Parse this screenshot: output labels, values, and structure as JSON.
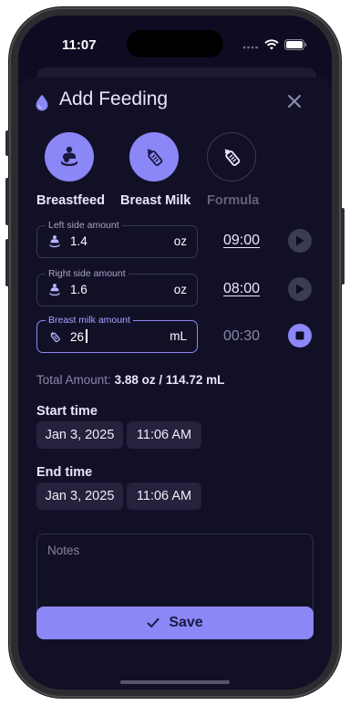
{
  "status": {
    "time": "11:07"
  },
  "header": {
    "title": "Add Feeding"
  },
  "types": [
    {
      "label": "Breastfeed",
      "active": true
    },
    {
      "label": "Breast Milk",
      "active": true
    },
    {
      "label": "Formula",
      "active": false
    }
  ],
  "fields": {
    "left": {
      "legend": "Left side amount",
      "value": "1.4",
      "unit": "oz",
      "timer": "09:00"
    },
    "right": {
      "legend": "Right side amount",
      "value": "1.6",
      "unit": "oz",
      "timer": "08:00"
    },
    "milk": {
      "legend": "Breast milk amount",
      "value": "26",
      "unit": "mL",
      "timer": "00:30"
    }
  },
  "total": {
    "label": "Total Amount:",
    "value": "3.88 oz / 114.72 mL"
  },
  "start": {
    "label": "Start time",
    "date": "Jan 3, 2025",
    "time": "11:06 AM"
  },
  "end": {
    "label": "End time",
    "date": "Jan 3, 2025",
    "time": "11:06 AM"
  },
  "notes": {
    "placeholder": "Notes"
  },
  "save": {
    "label": "Save"
  },
  "colors": {
    "accent": "#8c87f6",
    "background": "#121027",
    "chip": "#24223d"
  },
  "icons": [
    "droplet-icon",
    "close-icon",
    "breastfeed-icon",
    "bottle-icon",
    "play-icon",
    "stop-icon",
    "check-icon"
  ]
}
